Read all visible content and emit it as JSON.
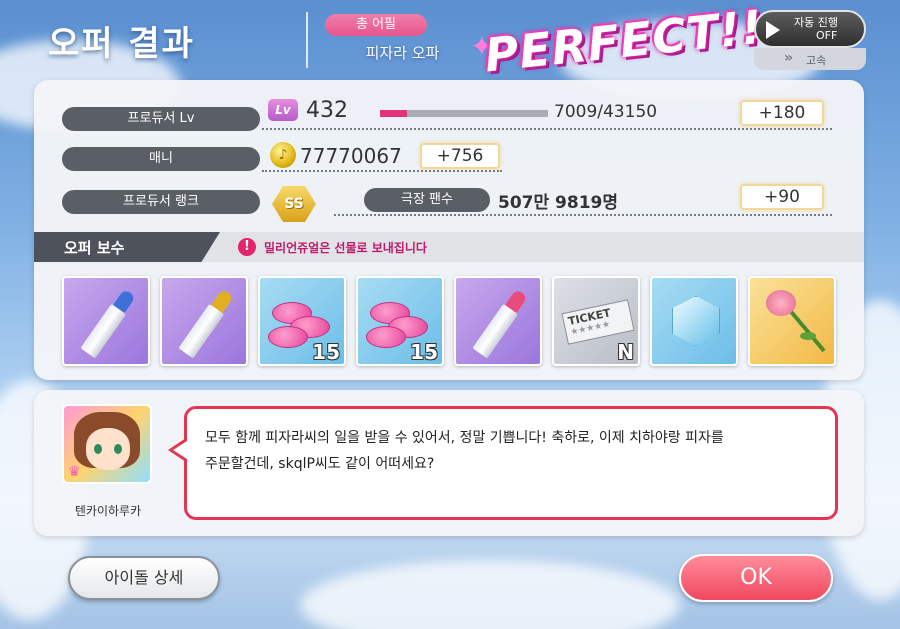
{
  "header": {
    "title": "오퍼 결과",
    "appeal_badge": "총 어필",
    "offer_name": "피자라 오파",
    "result": "PERFECT!!",
    "auto_play_label": "자동 진행",
    "auto_play_state": "OFF",
    "speed_label": "고속"
  },
  "stats": {
    "producer_lv_label": "프로듀서 Lv",
    "lv_icon_text": "Lv",
    "lv_value": "432",
    "exp_text": "7009/43150",
    "exp_fraction": 0.162,
    "lv_gain": "+180",
    "money_label": "매니",
    "money_value": "77770067",
    "money_gain": "+756",
    "rank_label": "프로듀서 랭크",
    "rank_value": "SS",
    "fans_label": "극장 팬수",
    "fans_value": "507만 9819명",
    "fans_gain": "+90"
  },
  "rewards": {
    "title": "오퍼 보수",
    "notice": "밀리언쥬얼은 선물로 보내집니다",
    "items": [
      {
        "name": "blue-lipstick",
        "count": ""
      },
      {
        "name": "gold-lipstick",
        "count": ""
      },
      {
        "name": "pink-candy",
        "count": "15"
      },
      {
        "name": "pink-candy",
        "count": "15"
      },
      {
        "name": "pink-lipstick",
        "count": ""
      },
      {
        "name": "ticket",
        "count": "N",
        "text": "TICKET"
      },
      {
        "name": "crystal",
        "count": ""
      },
      {
        "name": "rose",
        "count": ""
      }
    ]
  },
  "dialog": {
    "character_name": "텐카이하루카",
    "message_line1": "모두 함께 피자라씨의 일을 받을 수 있어서, 정말 기쁩니다! 축하로, 이제 치하야랑 피자를",
    "message_line2": "주문할건데, skqlP씨도 같이 어떠세요?"
  },
  "buttons": {
    "idol_detail": "아이돌 상세",
    "ok": "OK"
  },
  "colors": {
    "accent_pink": "#e43552",
    "ok_button": "#f0475f",
    "exp_fill": "#e3337a"
  }
}
